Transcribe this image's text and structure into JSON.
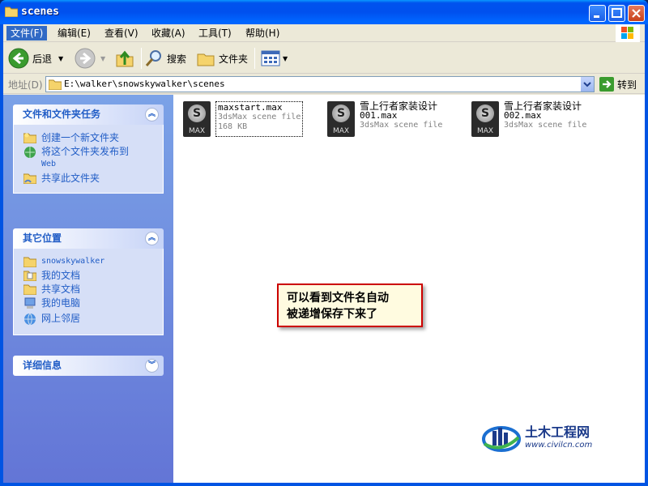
{
  "window": {
    "title": "scenes"
  },
  "menu": [
    "文件(F)",
    "编辑(E)",
    "查看(V)",
    "收藏(A)",
    "工具(T)",
    "帮助(H)"
  ],
  "toolbar": {
    "back_label": "后退",
    "search_label": "搜索",
    "folders_label": "文件夹"
  },
  "address": {
    "label": "地址(D)",
    "path": "E:\\walker\\snowskywalker\\scenes",
    "go_label": "转到"
  },
  "taskpane": {
    "file_tasks": {
      "title": "文件和文件夹任务",
      "items": [
        "创建一个新文件夹",
        "将这个文件夹发布到",
        "Web",
        "共享此文件夹"
      ]
    },
    "other_places": {
      "title": "其它位置",
      "items": [
        "snowskywalker",
        "我的文档",
        "共享文档",
        "我的电脑",
        "网上邻居"
      ]
    },
    "details": {
      "title": "详细信息"
    }
  },
  "files": [
    {
      "line1": "maxstart.max",
      "line2": "3dsMax scene file",
      "line3": "168 KB",
      "icon_text": "MAX"
    },
    {
      "line1": "雪上行者家装设计",
      "line2": "001.max",
      "line3": "3dsMax scene file",
      "icon_text": "MAX"
    },
    {
      "line1": "雪上行者家装设计",
      "line2": "002.max",
      "line3": "3dsMax scene file",
      "icon_text": "MAX"
    }
  ],
  "callout": {
    "line1": "可以看到文件名自动",
    "line2": "被递增保存下来了"
  },
  "watermark": {
    "title": "土木工程网",
    "url": "www.civilcn.com"
  },
  "colors": {
    "titlebar": "#0054e3",
    "taskpane": "#6375d6",
    "link": "#215dc6",
    "callout_border": "#cc0000"
  }
}
